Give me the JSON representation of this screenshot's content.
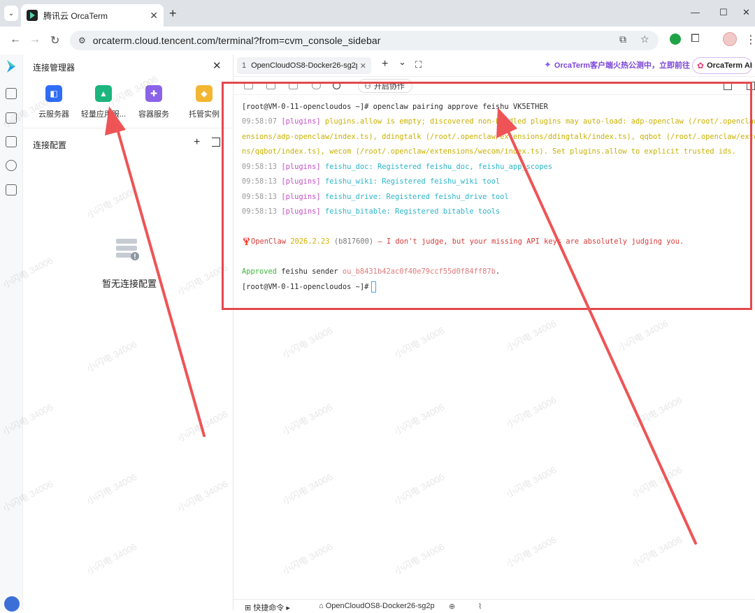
{
  "browser": {
    "tab_title": "腾讯云 OrcaTerm",
    "tab_close": "✕",
    "new_tab": "+",
    "url": "orcaterm.cloud.tencent.com/terminal?from=cvm_console_sidebar",
    "window_controls": [
      "—",
      "☐",
      "✕"
    ]
  },
  "sidebar_panel": {
    "title": "连接管理器",
    "close": "✕",
    "services": [
      {
        "label": "云服务器",
        "icon": "cloud-server-icon",
        "color": "#2f6df6"
      },
      {
        "label": "轻量应用服...",
        "icon": "lighthouse-icon",
        "color": "#1cb57c"
      },
      {
        "label": "容器服务",
        "icon": "container-icon",
        "color": "#8a63e8"
      },
      {
        "label": "托管实例",
        "icon": "managed-instance-icon",
        "color": "#f2b632"
      }
    ],
    "config_title": "连接配置",
    "config_add": "+",
    "empty_text": "暂无连接配置"
  },
  "terminal_tabs": {
    "active_tab_number": "1",
    "active_tab_title": "OpenCloudOS8-Docker26-sg2p",
    "tab_close": "✕",
    "add": "+",
    "dropdown": "⌄",
    "expand": "⛶",
    "promo_text": "OrcaTerm客户端火热公测中，立即前往",
    "ai_button": "OrcaTerm AI"
  },
  "toolbar": {
    "collab_label": "开启协作"
  },
  "terminal": {
    "prompt": "[root@VM-0-11-opencloudos ~]#",
    "command": " openclaw pairing approve feishu VK5ETHER",
    "warn_time": "09:58:07",
    "tag": "[plugins]",
    "warn_line1": " plugins.allow is empty; discovered non-bundled plugins may auto-load: adp-openclaw (/root/.openclaw/ext",
    "warn_line2": "ensions/adp-openclaw/index.ts), ddingtalk (/root/.openclaw/extensions/ddingtalk/index.ts), qqbot (/root/.openclaw/extensio",
    "warn_line3": "ns/qqbot/index.ts), wecom (/root/.openclaw/extensions/wecom/index.ts). Set plugins.allow to explicit trusted ids.",
    "reg_time": "09:58:13",
    "registered": [
      " feishu_doc: Registered feishu_doc, feishu_app_scopes",
      " feishu_wiki: Registered feishu_wiki tool",
      " feishu_drive: Registered feishu_drive tool",
      " feishu_bitable: Registered bitable tools"
    ],
    "banner_icon": "🦞",
    "banner_name": "OpenClaw",
    "banner_version": " 2026.2.23",
    "banner_build": " (b817600)",
    "banner_text": " — I don't judge, but your missing API keys are absolutely judging you.",
    "approved_word": "Approved",
    "approved_channel": " feishu",
    "approved_sender": " sender",
    "approved_id": " ou_b8431b42ac0f40e79ccf55d0f84ff87b",
    "approved_dot": ".",
    "final_prompt": "[root@VM-0-11-opencloudos ~]#"
  },
  "statusbar": {
    "shortcut_label": "快捷命令",
    "session_label": "OpenCloudOS8-Docker26-sg2p"
  },
  "watermark": "小闪电 34006",
  "colors": {
    "annotation_red": "#e3494d",
    "accent_purple": "#7b45d6"
  }
}
